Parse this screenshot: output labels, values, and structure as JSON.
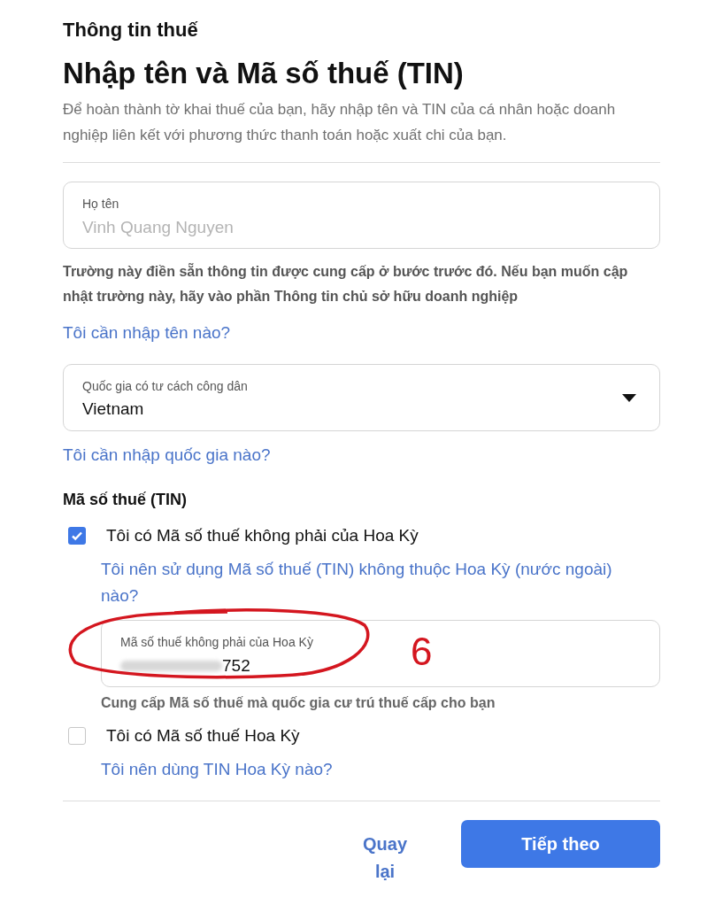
{
  "section_title": "Thông tin thuế",
  "title": "Nhập tên và Mã số thuế (TIN)",
  "description": "Để hoàn thành tờ khai thuế của bạn, hãy nhập tên và TIN của cá nhân hoặc doanh nghiệp liên kết với phương thức thanh toán hoặc xuất chi của bạn.",
  "name_field": {
    "label": "Họ tên",
    "value": "Vinh Quang Nguyen",
    "disabled": true
  },
  "name_help": "Trường này điền sẵn thông tin được cung cấp ở bước trước đó. Nếu bạn muốn cập nhật trường này, hãy vào phần Thông tin chủ sở hữu doanh nghiệp",
  "name_link": "Tôi cần nhập tên nào?",
  "country_select": {
    "label": "Quốc gia có tư cách công dân",
    "value": "Vietnam"
  },
  "country_link": "Tôi cần nhập quốc gia nào?",
  "tin_heading": "Mã số thuế (TIN)",
  "options": [
    {
      "label": "Tôi có Mã số thuế không phải của Hoa Kỳ",
      "checked": true,
      "link": "Tôi nên sử dụng Mã số thuế (TIN) không thuộc Hoa Kỳ (nước ngoài) nào?",
      "field": {
        "label": "Mã số thuế không phải của Hoa Kỳ",
        "value": "752",
        "redacted": true
      },
      "help": "Cung cấp Mã số thuế mà quốc gia cư trú thuế cấp cho bạn"
    },
    {
      "label": "Tôi có Mã số thuế Hoa Kỳ",
      "checked": false,
      "link": "Tôi nên dùng TIN Hoa Kỳ nào?"
    }
  ],
  "annotation": {
    "mark": "6"
  },
  "buttons": {
    "back": "Quay lại",
    "next": "Tiếp theo"
  }
}
